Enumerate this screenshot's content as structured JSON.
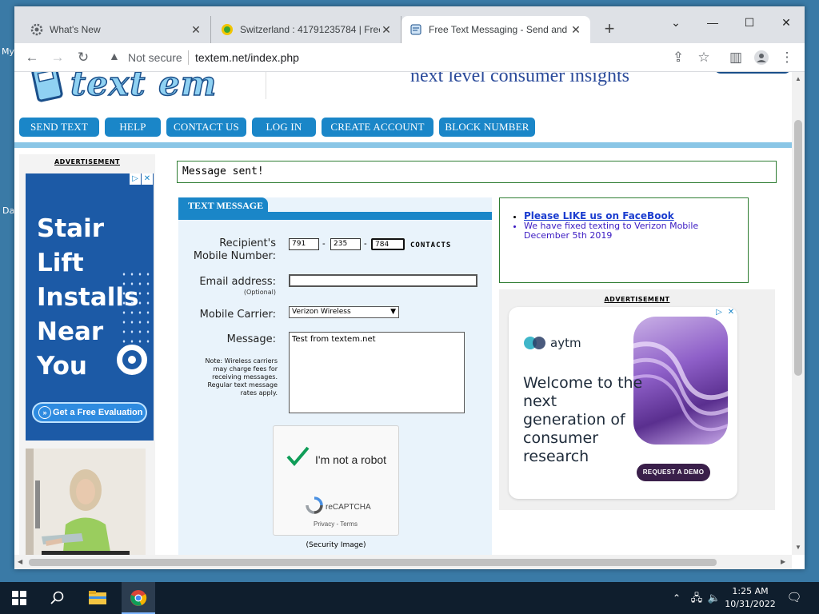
{
  "browser": {
    "tabs": [
      {
        "title": "What's New",
        "icon": "settings-gear-icon",
        "active": false
      },
      {
        "title": "Switzerland : 41791235784 | Free",
        "icon": "globe-favicon-icon",
        "active": false
      },
      {
        "title": "Free Text Messaging - Send and",
        "icon": "textem-favicon-icon",
        "active": true
      }
    ],
    "new_tab_symbol": "+",
    "security_label": "Not secure",
    "url": "textem.net/index.php"
  },
  "desktop": {
    "frag_top": "My",
    "frag_bottom": "Da"
  },
  "site": {
    "logo_text": "text em",
    "banner_text": "next level consumer insights",
    "nav": [
      "SEND TEXT",
      "HELP",
      "CONTACT US",
      "LOG IN",
      "CREATE ACCOUNT",
      "BLOCK NUMBER"
    ],
    "status_message": "Message sent!"
  },
  "left_ad": {
    "label": "ADVERTISEMENT",
    "headline": "Stair Lift Installs Near You",
    "cta": "Get a Free Evaluation"
  },
  "form": {
    "tab_label": "TEXT MESSAGE",
    "recipient_label_1": "Recipient's",
    "recipient_label_2": "Mobile Number:",
    "phone": [
      "791",
      "235",
      "784"
    ],
    "phone_sep": "-",
    "contacts_label": "CONTACTS",
    "email_label": "Email address:",
    "email_optional": "(Optional)",
    "email_value": "",
    "carrier_label": "Mobile Carrier:",
    "carrier_value": "Verizon Wireless",
    "message_label": "Message:",
    "message_value": "Test from textem.net",
    "note": "Note: Wireless carriers may charge fees for receiving messages. Regular text message rates apply.",
    "captcha_label": "I'm not a robot",
    "captcha_brand": "reCAPTCHA",
    "captcha_links": "Privacy - Terms",
    "security_image": "(Security Image)"
  },
  "news": {
    "facebook_link": "Please LIKE us on FaceBook",
    "verizon_note": "We have fixed texting to Verizon Mobile December 5th 2019"
  },
  "right_ad": {
    "label": "ADVERTISEMENT",
    "brand": "aytm",
    "copy": "Welcome to the next generation of consumer research",
    "cta": "REQUEST A DEMO"
  },
  "taskbar": {
    "time": "1:25 AM",
    "date": "10/31/2022"
  },
  "colors": {
    "nav_button": "#1a86c8",
    "status_border": "#2e7d32",
    "form_panel": "#e9f3fb",
    "left_ad_bg": "#1c5aa6",
    "taskbar": "#0f1e2d"
  }
}
